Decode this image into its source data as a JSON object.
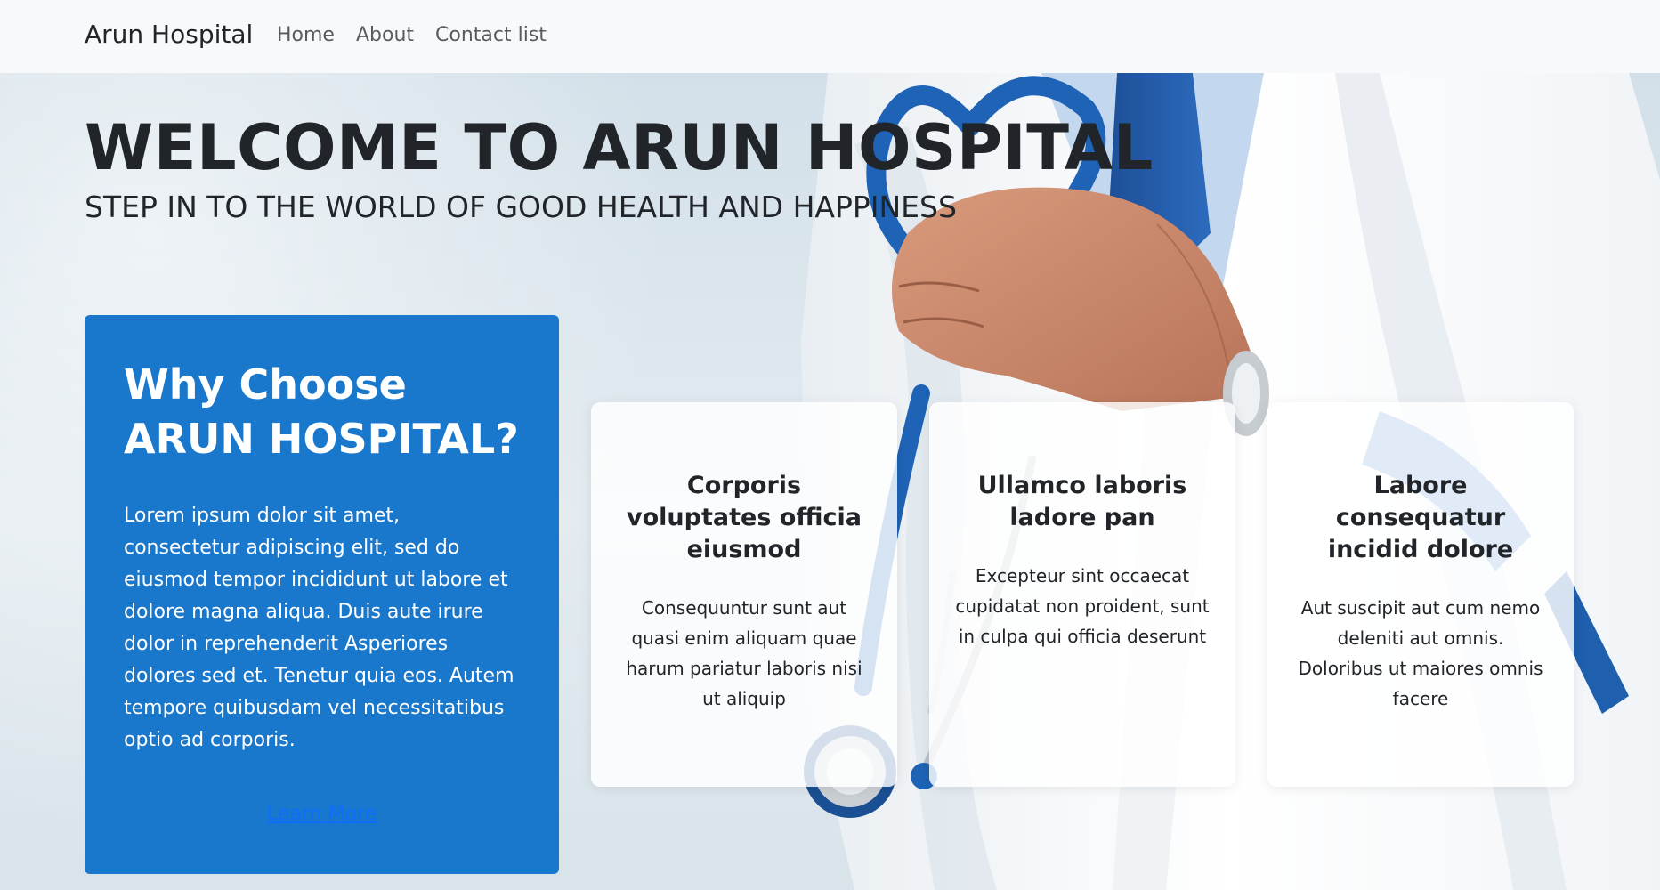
{
  "navbar": {
    "brand": "Arun Hospital",
    "links": [
      "Home",
      "About",
      "Contact list"
    ]
  },
  "hero": {
    "title": "WELCOME TO ARUN HOSPITAL",
    "subtitle": "STEP IN TO THE WORLD OF GOOD HEALTH AND HAPPINESS"
  },
  "why": {
    "title_line1": "Why Choose",
    "title_line2": "ARUN HOSPITAL?",
    "text": "Lorem ipsum dolor sit amet, consectetur adipiscing elit, sed do eiusmod tempor incididunt ut labore et dolore magna aliqua. Duis aute irure dolor in reprehenderit Asperiores dolores sed et. Tenetur quia eos. Autem tempore quibusdam vel necessitatibus optio ad corporis.",
    "learn_more": "Learn More"
  },
  "cards": [
    {
      "title": "Corporis voluptates officia eiusmod",
      "text": "Consequuntur sunt aut quasi enim aliquam quae harum pariatur laboris nisi ut aliquip"
    },
    {
      "title": "Ullamco laboris ladore pan",
      "text": "Excepteur sint occaecat cupidatat non proident, sunt in culpa qui officia deserunt"
    },
    {
      "title": "Labore consequatur incidid dolore",
      "text": "Aut suscipit aut cum nemo deleniti aut omnis. Doloribus ut maiores omnis facere"
    }
  ],
  "colors": {
    "navbar_bg": "#f8f9fa",
    "accent_blue": "#1977cc",
    "link_blue": "#0d6efd",
    "text_dark": "#212529"
  }
}
